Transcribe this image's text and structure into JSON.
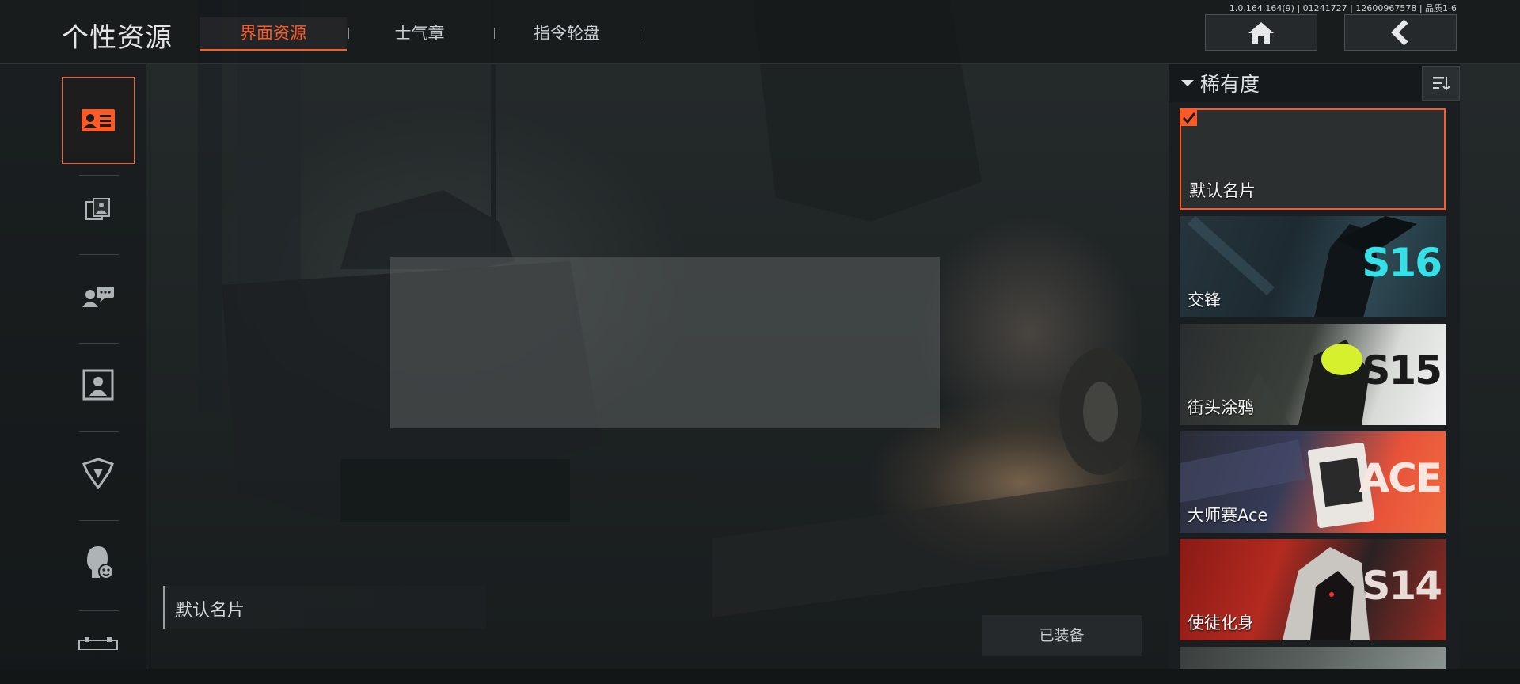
{
  "header": {
    "title": "个性资源",
    "version": "1.0.164.164(9) | 01241727 | 12600967578 | 品质1-6",
    "tabs": [
      {
        "label": "界面资源",
        "active": true
      },
      {
        "label": "士气章",
        "active": false
      },
      {
        "label": "指令轮盘",
        "active": false
      }
    ],
    "home_icon": "home-icon",
    "back_icon": "back-arrow-icon"
  },
  "sidebar": {
    "items": [
      {
        "icon": "name-card-icon",
        "active": true
      },
      {
        "icon": "photo-cards-icon",
        "active": false
      },
      {
        "icon": "chat-bubble-icon",
        "active": false
      },
      {
        "icon": "avatar-frame-icon",
        "active": false
      },
      {
        "icon": "badge-shield-icon",
        "active": false
      },
      {
        "icon": "emote-head-icon",
        "active": false
      },
      {
        "icon": "ticket-icon",
        "active": false
      }
    ]
  },
  "preview": {
    "name": "默认名片",
    "equip_status": "已装备"
  },
  "panel": {
    "filter_label": "稀有度",
    "sort_icon": "sort-icon",
    "cards": [
      {
        "label": "默认名片",
        "selected": true,
        "season": ""
      },
      {
        "label": "交锋",
        "selected": false,
        "season": "S16"
      },
      {
        "label": "街头涂鸦",
        "selected": false,
        "season": "S15"
      },
      {
        "label": "大师赛Ace",
        "selected": false,
        "season": "ACE"
      },
      {
        "label": "使徒化身",
        "selected": false,
        "season": "S14"
      }
    ]
  },
  "colors": {
    "accent": "#ff5a26",
    "panel_bg": "#1a1e20",
    "text": "#d8dadb"
  }
}
